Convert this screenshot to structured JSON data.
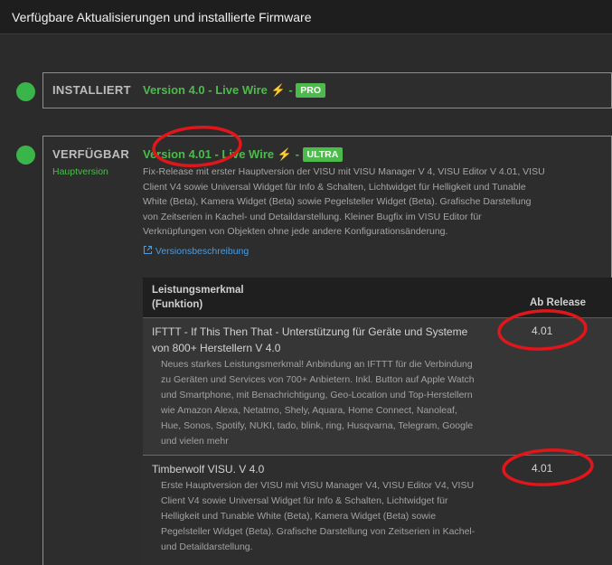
{
  "window": {
    "title": "Verfügbare Aktualisierungen und installierte Firmware"
  },
  "installed": {
    "status": "INSTALLIERT",
    "version": "Version 4.0 - Live Wire",
    "separator": "-",
    "bolt": "⚡",
    "badge": "PRO"
  },
  "available": {
    "status": "VERFÜGBAR",
    "sublabel": "Hauptversion",
    "version": "Version 4.01 - Live Wire",
    "separator": "-",
    "bolt": "⚡",
    "badge": "ULTRA",
    "description_lines": [
      "Fix-Release mit erster Hauptversion der VISU mit VISU Manager V 4, VISU Editor V 4.01, VISU",
      "Client V4 sowie Universal Widget für Info & Schalten, Lichtwidget für Helligkeit und Tunable",
      "White (Beta), Kamera Widget (Beta) sowie Pegelsteller Widget (Beta). Grafische Darstellung",
      "von Zeitserien in Kachel- und Detaildarstellung. Kleiner Bugfix im VISU Editor für",
      "Verknüpfungen von Objekten ohne jede andere Konfigurationsänderung."
    ],
    "link_label": "Versionsbeschreibung"
  },
  "table": {
    "header_feature_line1": "Leistungsmerkmal",
    "header_feature_line2": "(Funktion)",
    "header_release": "Ab Release",
    "rows": [
      {
        "title_lines": [
          "IFTTT - If This Then That - Unterstützung für Geräte und Systeme",
          "von 800+ Herstellern V 4.0"
        ],
        "desc_lines": [
          "Neues starkes Leistungsmerkmal! Anbindung an IFTTT für die Verbindung",
          "zu Geräten und Services von 700+ Anbietern. Inkl. Button auf Apple Watch",
          "und Smartphone, mit Benachrichtigung, Geo-Location und Top-Herstellern",
          "wie Amazon Alexa, Netatmo, Shely, Aquara, Home Connect, Nanoleaf,",
          "Hue, Sonos, Spotify, NUKI, tado, blink, ring, Husqvarna, Telegram, Google",
          "und vielen mehr"
        ],
        "release": "4.01"
      },
      {
        "title_lines": [
          "Timberwolf VISU. V 4.0"
        ],
        "desc_lines": [
          "Erste Hauptversion der VISU mit VISU Manager V4, VISU Editor V4, VISU",
          "Client V4 sowie Universal Widget für Info & Schalten, Lichtwidget für",
          "Helligkeit und Tunable White (Beta), Kamera Widget (Beta) sowie",
          "Pegelsteller Widget (Beta). Grafische Darstellung von Zeitserien in Kachel-",
          "und Detaildarstellung."
        ],
        "release": "4.01"
      }
    ]
  },
  "colors": {
    "accent_green": "#4cbb4c",
    "status_dot": "#39b54a",
    "link_blue": "#4a9be0",
    "annotation_red": "#e0161b",
    "bolt_yellow": "#f2c31b"
  }
}
